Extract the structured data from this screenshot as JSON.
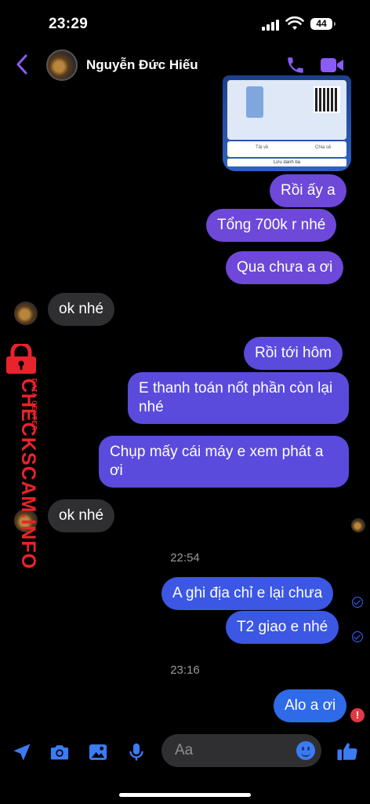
{
  "status_bar": {
    "time": "23:29",
    "battery": "44"
  },
  "header": {
    "contact_name": "Nguyễn Đức Hiếu"
  },
  "shared_image": {
    "label_left": "Tải về",
    "label_right": "Chia sẻ",
    "save_label": "Lưu danh bạ"
  },
  "messages": {
    "m1": "Rồi ấy a",
    "m2": "Tổng 700k r nhé",
    "m3": "Qua chưa a ơi",
    "m4": "ok nhé",
    "m5": "Rồi tới hôm",
    "m6": "E thanh toán nốt phần còn lại nhé",
    "m7": "Chụp mấy cái máy e xem phát a ơi",
    "m8": "ok nhé",
    "ts1": "22:54",
    "m9": "A ghi địa chỉ e lại chưa",
    "m10": "T2 giao e nhé",
    "ts2": "23:16",
    "m11": "Alo a ơi"
  },
  "watermark": {
    "brand": "CHECKSCAM.INFO",
    "sub": "DATA CENTER"
  },
  "composer": {
    "placeholder": "Aa"
  },
  "colors": {
    "accent": "#8a5cf6",
    "outgoing_blue": "#3b57e4",
    "incoming": "#2f2f31",
    "error": "#e03a44"
  }
}
